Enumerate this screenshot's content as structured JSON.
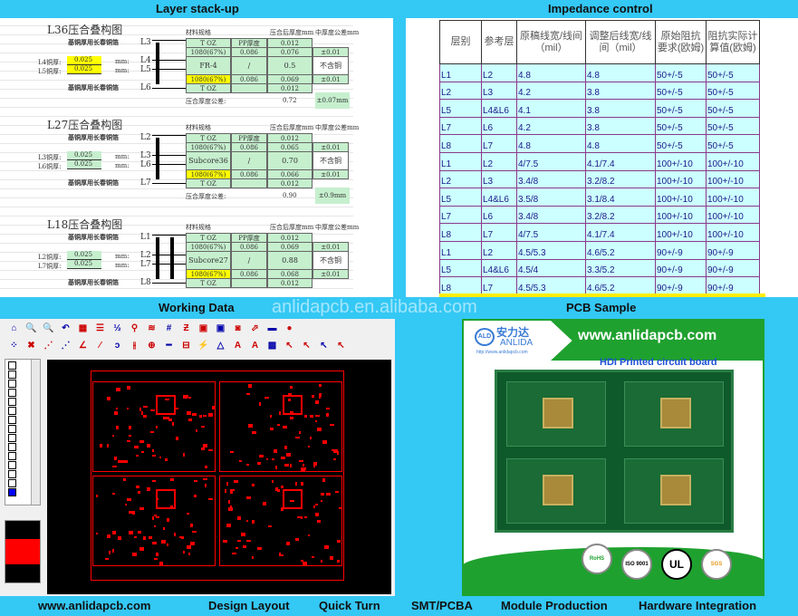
{
  "top_bar": {
    "left": "Layer stack-up",
    "right": "Impedance control"
  },
  "middle_bar": {
    "left": "Working Data",
    "watermark": "anlidapcb.en.alibaba.com",
    "right": "PCB Sample"
  },
  "bottom_bar": [
    "www.anlidapcb.com",
    "Design Layout",
    "Quick Turn",
    "SMT/PCBA",
    "Module Production",
    "Hardware Integration"
  ],
  "stackup": {
    "headers": {
      "material": "材料规格",
      "thickness": "压合后厚度mm",
      "tolerance": "中厚度公差mm",
      "pp": "PP厚度"
    },
    "copper_label": "基铜厚用长春铜箔",
    "unit": "mm:",
    "total_label": "压合厚度公差:",
    "sections": [
      {
        "title": "L36压合叠构图",
        "top": "L3",
        "mid1": "L4",
        "mid2": "L5",
        "bot": "L6",
        "mid1_label": "L4铜厚:",
        "mid2_label": "L5铜厚:",
        "cu1": "0.025",
        "cu2": "0.025",
        "cu_highlight": true,
        "rows": [
          [
            "T OZ",
            "PP厚度",
            "0.012",
            ""
          ],
          [
            "1080(67%)",
            "0.086",
            "0.076",
            "±0.01"
          ],
          [
            "FR-4",
            "/",
            "0.5",
            "不含铜"
          ],
          [
            "1080(67%)",
            "0.086",
            "0.069",
            "±0.01"
          ],
          [
            "T OZ",
            "",
            "0.012",
            ""
          ]
        ],
        "total": "0.72",
        "total_tol": "±0.07mm"
      },
      {
        "title": "L27压合叠构图",
        "top": "L2",
        "mid1": "L3",
        "mid2": "L6",
        "bot": "L7",
        "mid1_label": "L3铜厚:",
        "mid2_label": "L6铜厚:",
        "cu1": "0.025",
        "cu2": "0.025",
        "cu_highlight": false,
        "rows": [
          [
            "T OZ",
            "PP厚度",
            "0.012",
            ""
          ],
          [
            "1080(67%)",
            "0.086",
            "0.065",
            "±0.01"
          ],
          [
            "Subcore36",
            "/",
            "0.70",
            "不含铜"
          ],
          [
            "1080(67%)",
            "0.086",
            "0.066",
            "±0.01"
          ],
          [
            "T OZ",
            "",
            "0.012",
            ""
          ]
        ],
        "total": "0.90",
        "total_tol": "±0.9mm"
      },
      {
        "title": "L18压合叠构图",
        "top": "L1",
        "mid1": "L2",
        "mid2": "L7",
        "bot": "L8",
        "mid1_label": "L2铜厚:",
        "mid2_label": "L7铜厚:",
        "cu1": "0.025",
        "cu2": "0.025",
        "cu_highlight": false,
        "rows": [
          [
            "T OZ",
            "PP厚度",
            "0.012",
            ""
          ],
          [
            "1080(67%)",
            "0.086",
            "0.069",
            "±0.01"
          ],
          [
            "Subcore27",
            "/",
            "0.88",
            "不含铜"
          ],
          [
            "1080(67%)",
            "0.086",
            "0.068",
            "±0.01"
          ],
          [
            "T OZ",
            "",
            "0.012",
            ""
          ]
        ],
        "total": "",
        "total_tol": ""
      }
    ]
  },
  "impedance": {
    "headers": [
      "层别",
      "参考层",
      "原稿线宽/线间（mil）",
      "调整后线宽/线间（mil）",
      "原始阻抗要求(欧姆)",
      "阻抗实际计算值(欧姆)"
    ],
    "rows": [
      [
        "L1",
        "L2",
        "4.8",
        "4.8",
        "50+/-5",
        "50+/-5"
      ],
      [
        "L2",
        "L3",
        "4.2",
        "3.8",
        "50+/-5",
        "50+/-5"
      ],
      [
        "L5",
        "L4&L6",
        "4.1",
        "3.8",
        "50+/-5",
        "50+/-5"
      ],
      [
        "L7",
        "L6",
        "4.2",
        "3.8",
        "50+/-5",
        "50+/-5"
      ],
      [
        "L8",
        "L7",
        "4.8",
        "4.8",
        "50+/-5",
        "50+/-5"
      ],
      [
        "L1",
        "L2",
        "4/7.5",
        "4.1/7.4",
        "100+/-10",
        "100+/-10"
      ],
      [
        "L2",
        "L3",
        "3.4/8",
        "3.2/8.2",
        "100+/-10",
        "100+/-10"
      ],
      [
        "L5",
        "L4&L6",
        "3.5/8",
        "3.1/8.4",
        "100+/-10",
        "100+/-10"
      ],
      [
        "L7",
        "L6",
        "3.4/8",
        "3.2/8.2",
        "100+/-10",
        "100+/-10"
      ],
      [
        "L8",
        "L7",
        "4/7.5",
        "4.1/7.4",
        "100+/-10",
        "100+/-10"
      ],
      [
        "L1",
        "L2",
        "4.5/5.3",
        "4.6/5.2",
        "90+/-9",
        "90+/-9"
      ],
      [
        "L5",
        "L4&L6",
        "4.5/4",
        "3.3/5.2",
        "90+/-9",
        "90+/-9"
      ],
      [
        "L8",
        "L7",
        "4.5/5.3",
        "4.6/5.2",
        "90+/-9",
        "90+/-9"
      ]
    ]
  },
  "cad": {
    "toolbar1": [
      "⌂",
      "🔍",
      "🔍",
      "↶",
      "▦",
      "☰",
      "½",
      "⚲",
      "≋",
      "#",
      "Ƶ",
      "▣",
      "▣",
      "◙",
      "⬀",
      "▬",
      "●"
    ],
    "toolbar2": [
      "⁘",
      "✖",
      "⋰",
      "⋰",
      "∠",
      "⁄",
      "ↄ",
      "⫲",
      "⊕",
      "━",
      "⊟",
      "⚡",
      "△",
      "A",
      "A",
      "▩",
      "↖",
      "↖",
      "↖",
      "↖"
    ],
    "layer_colors": [
      "#ffffff",
      "#000000",
      "#ff0000",
      "#000000"
    ],
    "board_color": "#ff0000"
  },
  "sample": {
    "brand_short": "ALD",
    "brand_cn": "安力达",
    "brand": "ANLIDA",
    "brand_url": "http://www.anlidapcb.com",
    "url": "www.anlidapcb.com",
    "title": "HDI Printed circuit board",
    "badges": [
      "RoHS",
      "ISO 9001",
      "UL",
      "SGS"
    ]
  },
  "colors": {
    "bar": "#34c8f5",
    "green": "#1fa12f",
    "board": "#0e5a2a",
    "cad_red": "#ff0000"
  }
}
